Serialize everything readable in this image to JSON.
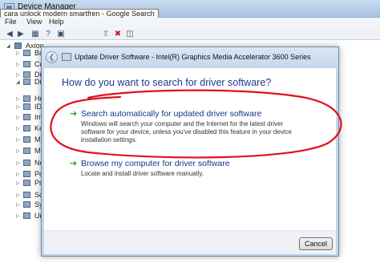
{
  "device_manager": {
    "title": "Device Manager",
    "tooltip": "cara unlock modern smartfren - Google Search",
    "menu": [
      {
        "label": "File"
      },
      {
        "label": "View"
      },
      {
        "label": "Help"
      }
    ],
    "toolbar_icons": [
      "back-icon",
      "forward-icon",
      "grid-icon",
      "help-icon",
      "properties-icon",
      "update-driver-icon",
      "uninstall-icon",
      "scan-icon"
    ],
    "tree": {
      "root_label": "Axioo",
      "items": [
        {
          "label": "Ba",
          "icon": "battery-icon"
        },
        {
          "label": "Co",
          "icon": "computer-icon"
        },
        {
          "label": "Di",
          "icon": "disk-icon"
        },
        {
          "label": "Di",
          "icon": "display-icon"
        },
        {
          "label": "Hu",
          "icon": "hid-icon"
        },
        {
          "label": "ID",
          "icon": "ide-icon"
        },
        {
          "label": "Im",
          "icon": "imaging-icon"
        },
        {
          "label": "Ke",
          "icon": "keyboard-icon"
        },
        {
          "label": "Mi",
          "icon": "mouse-icon"
        },
        {
          "label": "Mo",
          "icon": "monitor-icon"
        },
        {
          "label": "Ne",
          "icon": "network-icon"
        },
        {
          "label": "Po",
          "icon": "ports-icon"
        },
        {
          "label": "Pr",
          "icon": "processor-icon"
        },
        {
          "label": "So",
          "icon": "sound-icon"
        },
        {
          "label": "Sy",
          "icon": "system-icon"
        },
        {
          "label": "Ur",
          "icon": "usb-icon"
        }
      ]
    }
  },
  "dialog": {
    "title": "Update Driver Software - Intel(R) Graphics Media Accelerator 3600 Series",
    "question": "How do you want to search for driver software?",
    "options": [
      {
        "title": "Search automatically for updated driver software",
        "description": "Windows will search your computer and the Internet for the latest driver software for your device, unless you've disabled this feature in your device installation settings."
      },
      {
        "title": "Browse my computer for driver software",
        "description": "Locate and install driver software manually."
      }
    ],
    "cancel_label": "Cancel"
  },
  "colors": {
    "question_text": "#1e3a8c",
    "option_title": "#0b3a8a",
    "arrow_green": "#2f9e2f",
    "annotation_red": "#e0121b"
  }
}
